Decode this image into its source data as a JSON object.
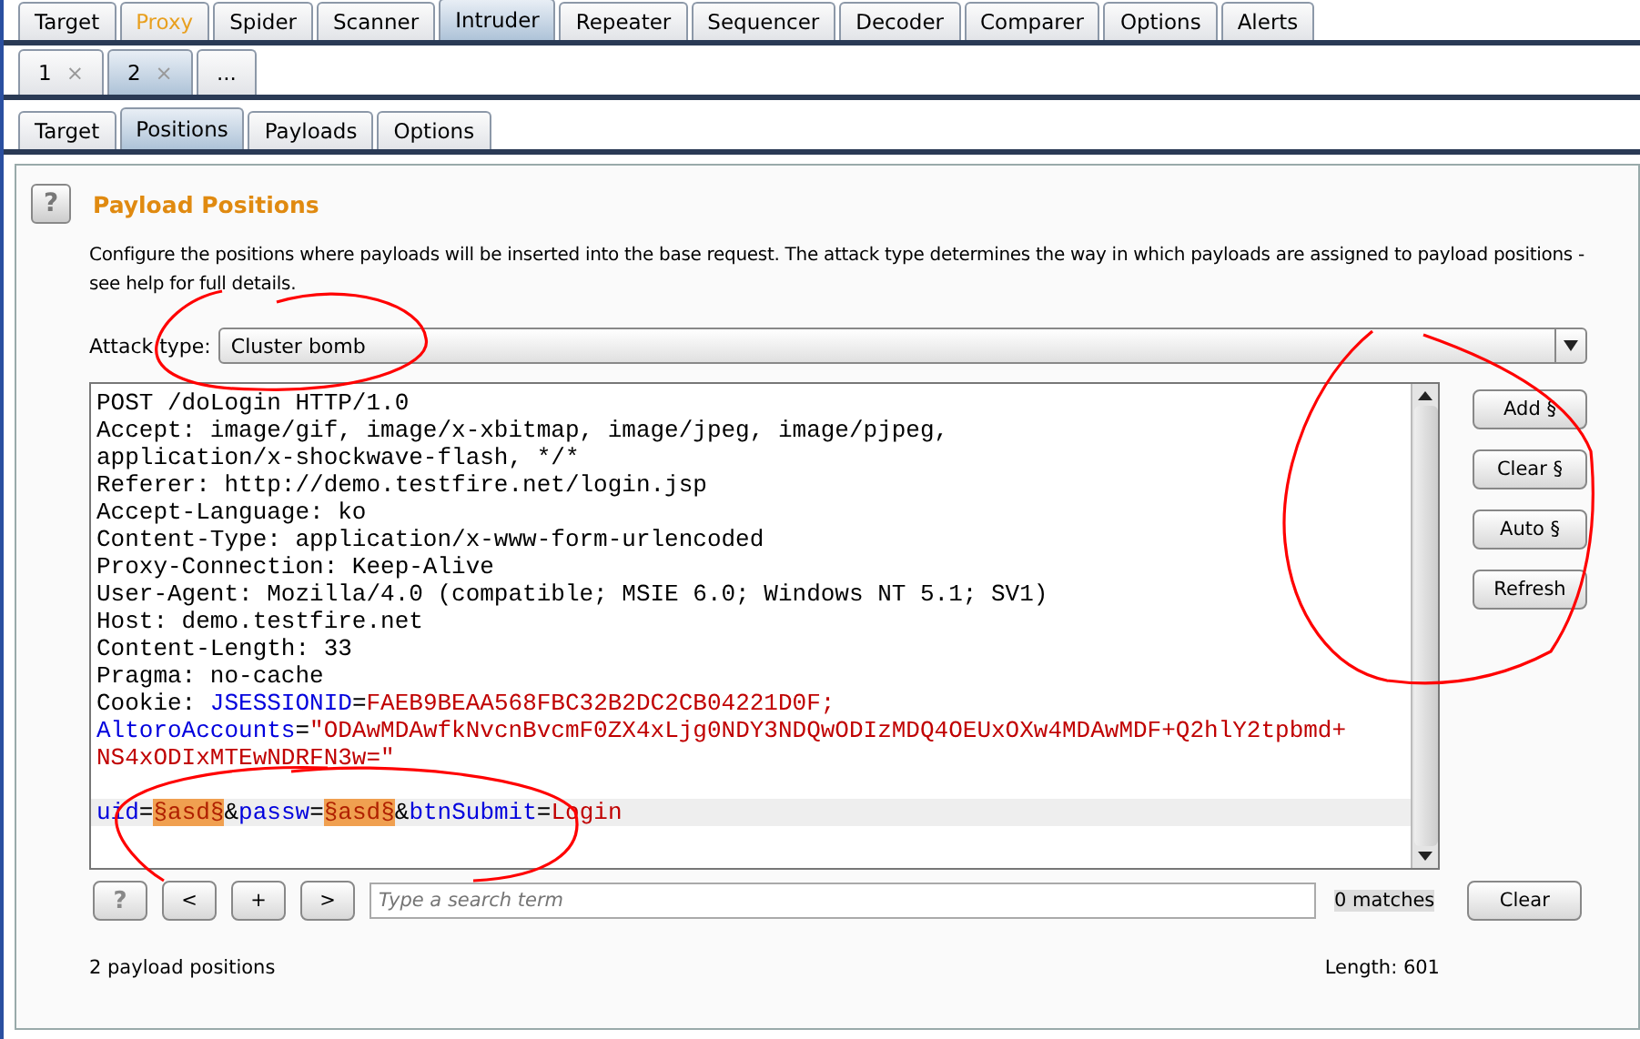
{
  "main_tabs": [
    {
      "label": "Target",
      "selected": false,
      "highlighted": false
    },
    {
      "label": "Proxy",
      "selected": false,
      "highlighted": true
    },
    {
      "label": "Spider",
      "selected": false,
      "highlighted": false
    },
    {
      "label": "Scanner",
      "selected": false,
      "highlighted": false
    },
    {
      "label": "Intruder",
      "selected": true,
      "highlighted": false
    },
    {
      "label": "Repeater",
      "selected": false,
      "highlighted": false
    },
    {
      "label": "Sequencer",
      "selected": false,
      "highlighted": false
    },
    {
      "label": "Decoder",
      "selected": false,
      "highlighted": false
    },
    {
      "label": "Comparer",
      "selected": false,
      "highlighted": false
    },
    {
      "label": "Options",
      "selected": false,
      "highlighted": false
    },
    {
      "label": "Alerts",
      "selected": false,
      "highlighted": false
    }
  ],
  "attack_tabs": [
    {
      "label": "1",
      "close": "×",
      "selected": false
    },
    {
      "label": "2",
      "close": "×",
      "selected": true
    },
    {
      "label": "...",
      "selected": false
    }
  ],
  "sub_tabs": [
    {
      "label": "Target",
      "selected": false
    },
    {
      "label": "Positions",
      "selected": true
    },
    {
      "label": "Payloads",
      "selected": false
    },
    {
      "label": "Options",
      "selected": false
    }
  ],
  "panel": {
    "help": "?",
    "title": "Payload Positions",
    "description": "Configure the positions where payloads will be inserted into the base request. The attack type determines the way in which payloads are assigned to payload positions - see help for full details.",
    "attack_type_label": "Attack type:",
    "attack_type": "Cluster bomb"
  },
  "request": [
    {
      "segments": [
        {
          "kind": "plain",
          "text": "POST /doLogin HTTP/1.0"
        }
      ]
    },
    {
      "segments": [
        {
          "kind": "plain",
          "text": "Accept: image/gif, image/x-xbitmap, image/jpeg, image/pjpeg,"
        }
      ]
    },
    {
      "segments": [
        {
          "kind": "plain",
          "text": "application/x-shockwave-flash, */*"
        }
      ]
    },
    {
      "segments": [
        {
          "kind": "plain",
          "text": "Referer: http://demo.testfire.net/login.jsp"
        }
      ]
    },
    {
      "segments": [
        {
          "kind": "plain",
          "text": "Accept-Language: ko"
        }
      ]
    },
    {
      "segments": [
        {
          "kind": "plain",
          "text": "Content-Type: application/x-www-form-urlencoded"
        }
      ]
    },
    {
      "segments": [
        {
          "kind": "plain",
          "text": "Proxy-Connection: Keep-Alive"
        }
      ]
    },
    {
      "segments": [
        {
          "kind": "plain",
          "text": "User-Agent: Mozilla/4.0 (compatible; MSIE 6.0; Windows NT 5.1; SV1)"
        }
      ]
    },
    {
      "segments": [
        {
          "kind": "plain",
          "text": "Host: demo.testfire.net"
        }
      ]
    },
    {
      "segments": [
        {
          "kind": "plain",
          "text": "Content-Length: 33"
        }
      ]
    },
    {
      "segments": [
        {
          "kind": "plain",
          "text": "Pragma: no-cache"
        }
      ]
    },
    {
      "segments": [
        {
          "kind": "plain",
          "text": "Cookie: "
        },
        {
          "kind": "name",
          "text": "JSESSIONID"
        },
        {
          "kind": "plain",
          "text": "="
        },
        {
          "kind": "value",
          "text": "FAEB9BEAA568FBC32B2DC2CB04221D0F;"
        }
      ]
    },
    {
      "segments": [
        {
          "kind": "name",
          "text": "AltoroAccounts"
        },
        {
          "kind": "plain",
          "text": "="
        },
        {
          "kind": "value",
          "text": "\"ODAwMDAwfkNvcnBvcmF0ZX4xLjg0NDY3NDQwODIzMDQ4OEUxOXw4MDAwMDF+Q2hlY2tpbmd+"
        }
      ]
    },
    {
      "segments": [
        {
          "kind": "value",
          "text": "NS4xODIxMTEwNDRFN3w=\""
        }
      ]
    }
  ],
  "cursor_line": {
    "segments": [
      {
        "kind": "name",
        "text": "uid"
      },
      {
        "kind": "plain",
        "text": "="
      },
      {
        "kind": "marker",
        "text": "§asd§"
      },
      {
        "kind": "plain",
        "text": "&"
      },
      {
        "kind": "name",
        "text": "passw"
      },
      {
        "kind": "plain",
        "text": "="
      },
      {
        "kind": "marker",
        "text": "§asd§"
      },
      {
        "kind": "plain",
        "text": "&"
      },
      {
        "kind": "name",
        "text": "btnSubmit"
      },
      {
        "kind": "plain",
        "text": "="
      },
      {
        "kind": "value",
        "text": "Login"
      }
    ]
  },
  "side_buttons": [
    "Add §",
    "Clear §",
    "Auto §",
    "Refresh"
  ],
  "search": {
    "help": "?",
    "prev": "<",
    "add": "+",
    "next": ">",
    "placeholder": "Type a search term",
    "matches": "0 matches",
    "clear": "Clear"
  },
  "status": {
    "positions": "2 payload positions",
    "length": "Length: 601"
  }
}
